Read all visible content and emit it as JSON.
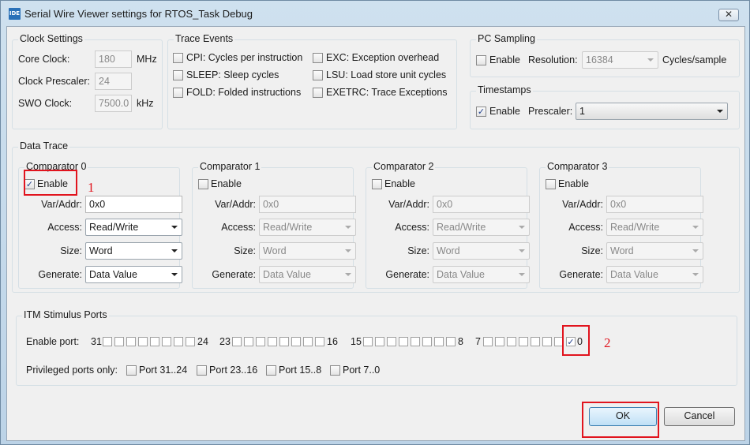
{
  "window": {
    "title": "Serial Wire Viewer settings for RTOS_Task Debug",
    "icon_text": "IDE",
    "close_label": "✕"
  },
  "clock": {
    "group_title": "Clock Settings",
    "core_label": "Core Clock:",
    "core_value": "180",
    "core_unit": "MHz",
    "prescaler_label": "Clock Prescaler:",
    "prescaler_value": "24",
    "swo_label": "SWO Clock:",
    "swo_value": "7500.0",
    "swo_unit": "kHz"
  },
  "trace_events": {
    "group_title": "Trace Events",
    "items": [
      {
        "label": "CPI: Cycles per instruction",
        "checked": false
      },
      {
        "label": "SLEEP: Sleep cycles",
        "checked": false
      },
      {
        "label": "FOLD: Folded instructions",
        "checked": false
      },
      {
        "label": "EXC: Exception overhead",
        "checked": false
      },
      {
        "label": "LSU: Load store unit cycles",
        "checked": false
      },
      {
        "label": "EXETRC: Trace Exceptions",
        "checked": false
      }
    ]
  },
  "pc_sampling": {
    "group_title": "PC Sampling",
    "enable_label": "Enable",
    "resolution_label": "Resolution:",
    "resolution_value": "16384",
    "unit": "Cycles/sample"
  },
  "timestamps": {
    "group_title": "Timestamps",
    "enable_label": "Enable",
    "prescaler_label": "Prescaler:",
    "prescaler_value": "1"
  },
  "data_trace": {
    "group_title": "Data Trace",
    "labels": {
      "enable": "Enable",
      "var_addr": "Var/Addr:",
      "access": "Access:",
      "size": "Size:",
      "generate": "Generate:"
    },
    "comparators": [
      {
        "title": "Comparator 0",
        "enabled": true,
        "addr": "0x0",
        "access": "Read/Write",
        "size": "Word",
        "generate": "Data Value"
      },
      {
        "title": "Comparator 1",
        "enabled": false,
        "addr": "0x0",
        "access": "Read/Write",
        "size": "Word",
        "generate": "Data Value"
      },
      {
        "title": "Comparator 2",
        "enabled": false,
        "addr": "0x0",
        "access": "Read/Write",
        "size": "Word",
        "generate": "Data Value"
      },
      {
        "title": "Comparator 3",
        "enabled": false,
        "addr": "0x0",
        "access": "Read/Write",
        "size": "Word",
        "generate": "Data Value"
      }
    ]
  },
  "itm": {
    "group_title": "ITM Stimulus Ports",
    "enable_port_label": "Enable port:",
    "port_groups": [
      {
        "start": "31",
        "end": "24"
      },
      {
        "start": "23",
        "end": "16"
      },
      {
        "start": "15",
        "end": "8"
      },
      {
        "start": "7",
        "end": "0"
      }
    ],
    "checked_port": "0",
    "privileged_label": "Privileged ports only:",
    "privileged": [
      "Port 31..24",
      "Port 23..16",
      "Port 15..8",
      "Port 7..0"
    ]
  },
  "buttons": {
    "ok": "OK",
    "cancel": "Cancel"
  },
  "annotations": [
    "1",
    "2"
  ],
  "colors": {
    "annotation": "#e1141e",
    "title_bar": "#c7dced"
  }
}
